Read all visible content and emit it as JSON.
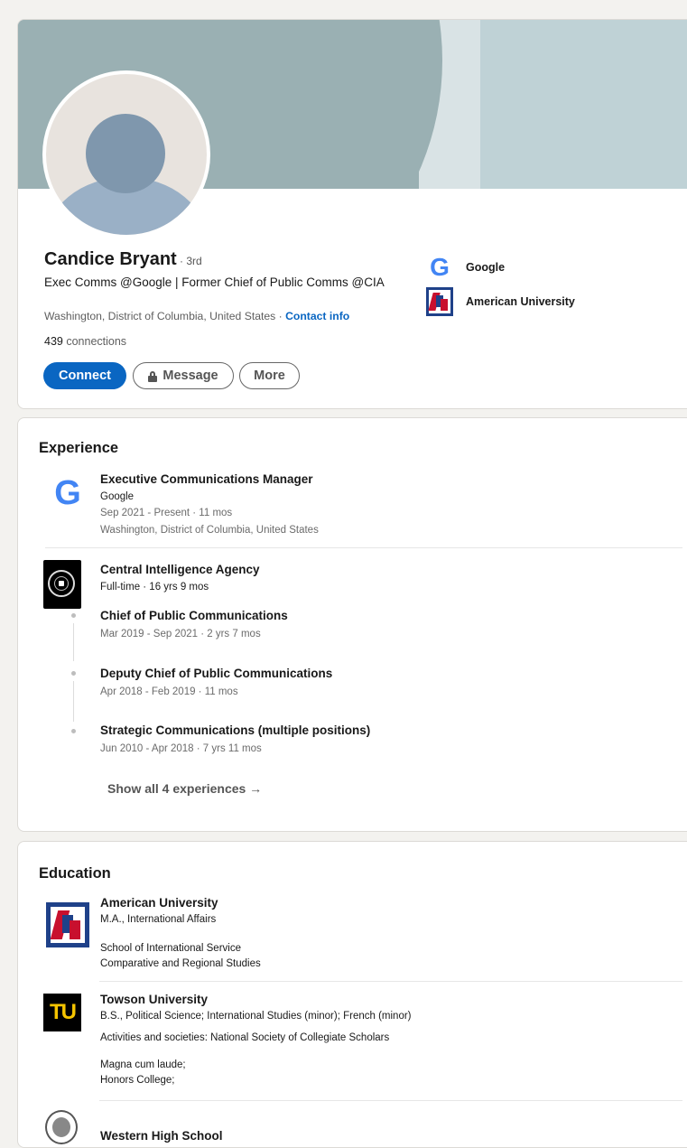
{
  "profile": {
    "name": "Candice Bryant",
    "degree": " · 3rd",
    "headline": "Exec Comms @Google | Former Chief of Public Comms @CIA",
    "location": "Washington, District of Columbia, United States · ",
    "contact_info": "Contact info",
    "connections_count": "439",
    "connections_label": " connections",
    "buttons": {
      "connect": "Connect",
      "message": "Message",
      "more": "More"
    },
    "side_orgs": [
      {
        "name": "Google",
        "icon": "google-logo"
      },
      {
        "name": "American University",
        "icon": "american-university-logo"
      }
    ]
  },
  "experience": {
    "title": "Experience",
    "google": {
      "logo_letter": "G",
      "title": "Executive Communications Manager",
      "company": "Google",
      "dates": "Sep 2021 - Present · 11 mos",
      "location": "Washington, District of Columbia, United States"
    },
    "cia": {
      "company": "Central Intelligence Agency",
      "summary": "Full-time · 16 yrs 9 mos",
      "roles": [
        {
          "title": "Chief of Public Communications",
          "dates": "Mar 2019 - Sep 2021 · 2 yrs 7 mos"
        },
        {
          "title": "Deputy Chief of Public Communications",
          "dates": "Apr 2018 - Feb 2019 · 11 mos"
        },
        {
          "title": "Strategic Communications (multiple positions)",
          "dates": "Jun 2010 - Apr 2018 · 7 yrs 11 mos"
        }
      ]
    },
    "show_all": "Show all 4 experiences →"
  },
  "education": {
    "title": "Education",
    "schools": [
      {
        "name": "American University",
        "degree": "M.A., International Affairs",
        "details": [
          "School of International Service",
          "Comparative and Regional Studies"
        ]
      },
      {
        "name": "Towson University",
        "logo_text": "TU",
        "degree": "B.S., Political Science; International Studies (minor); French (minor)",
        "activities": "Activities and societies: National Society of Collegiate Scholars",
        "details": [
          "Magna cum laude;",
          "Honors College;"
        ]
      },
      {
        "name": "Western High School"
      }
    ]
  },
  "colors": {
    "accent": "#0a66c2",
    "page_bg": "#f3f2ef",
    "banner": "#9ab0b3",
    "google_blue": "#4285f4",
    "au_blue": "#1f4189",
    "au_red": "#c8102e",
    "tu_gold": "#f5c400"
  }
}
